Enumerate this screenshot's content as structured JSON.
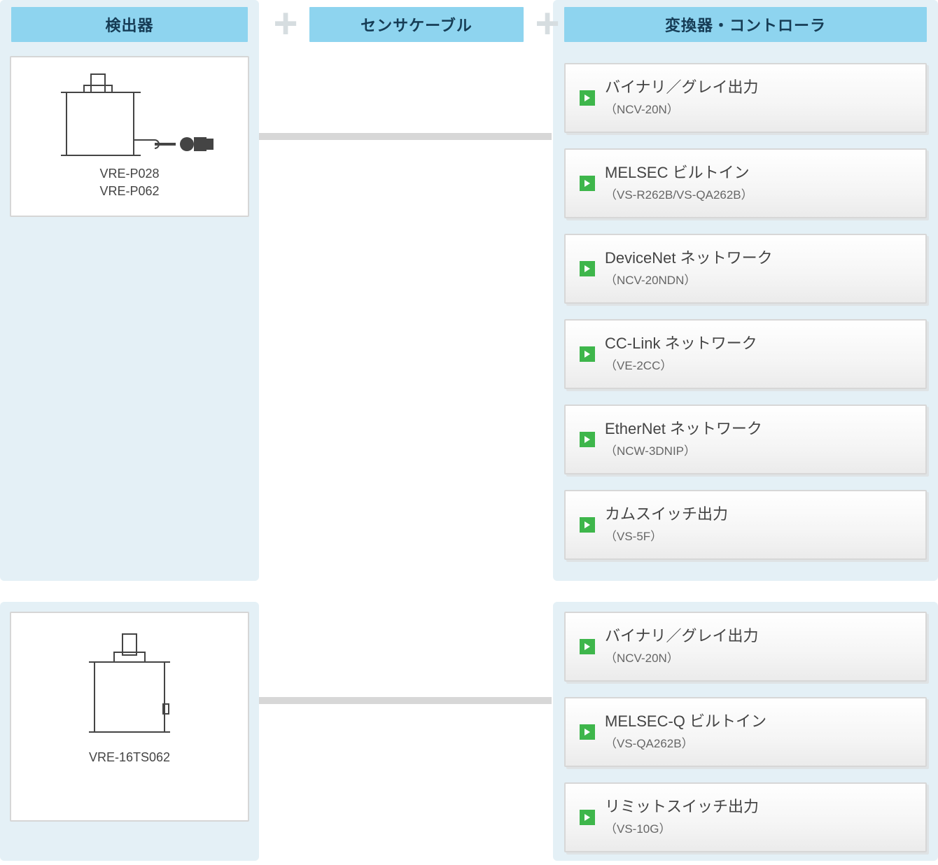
{
  "headers": {
    "left": "検出器",
    "middle": "センサケーブル",
    "right": "変換器・コントローラ"
  },
  "detectors": {
    "group1": {
      "labels": [
        "VRE-P028",
        "VRE-P062"
      ]
    },
    "group2": {
      "labels": [
        "VRE-16TS062"
      ]
    }
  },
  "controllers1": [
    {
      "title": "バイナリ／グレイ出力",
      "sub": "（NCV-20N）"
    },
    {
      "title": "MELSEC ビルトイン",
      "sub": "（VS-R262B/VS-QA262B）"
    },
    {
      "title": "DeviceNet ネットワーク",
      "sub": "（NCV-20NDN）"
    },
    {
      "title": "CC-Link ネットワーク",
      "sub": "（VE-2CC）"
    },
    {
      "title": "EtherNet ネットワーク",
      "sub": "（NCW-3DNIP）"
    },
    {
      "title": "カムスイッチ出力",
      "sub": "（VS-5F）"
    }
  ],
  "controllers2": [
    {
      "title": "バイナリ／グレイ出力",
      "sub": "（NCV-20N）"
    },
    {
      "title": "MELSEC-Q ビルトイン",
      "sub": "（VS-QA262B）"
    },
    {
      "title": "リミットスイッチ出力",
      "sub": "（VS-10G）"
    }
  ]
}
